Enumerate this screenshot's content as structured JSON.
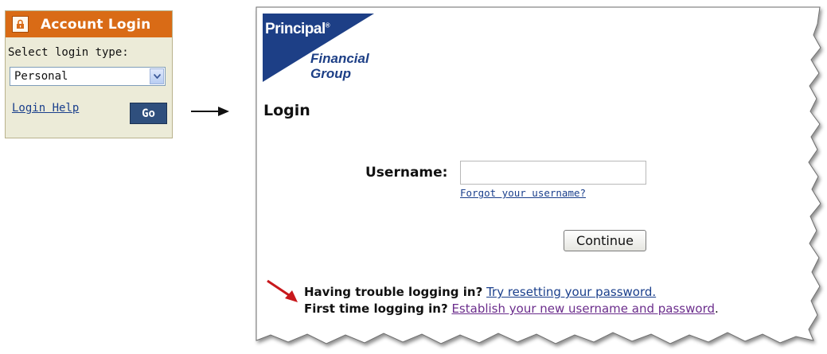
{
  "widget": {
    "title": "Account Login",
    "icon": "lock-icon",
    "select_label": "Select login type:",
    "select_value": "Personal",
    "help_link": "Login Help",
    "go_label": "Go",
    "colors": {
      "header": "#d96b16",
      "go_button": "#2f4f7d",
      "background": "#ecebd8"
    }
  },
  "login_page": {
    "logo": {
      "line1": "Principal",
      "registered": "®",
      "line2": "Financial",
      "line3": "Group",
      "color": "#1d3f86"
    },
    "heading": "Login",
    "username_label": "Username:",
    "username_value": "",
    "forgot_link": "Forgot your username?",
    "continue_label": "Continue",
    "trouble_text": "Having trouble logging in?",
    "trouble_link": "Try resetting your password.",
    "first_time_text": "First time logging in?",
    "first_time_link": "Establish your new username and password",
    "first_time_end": "."
  }
}
